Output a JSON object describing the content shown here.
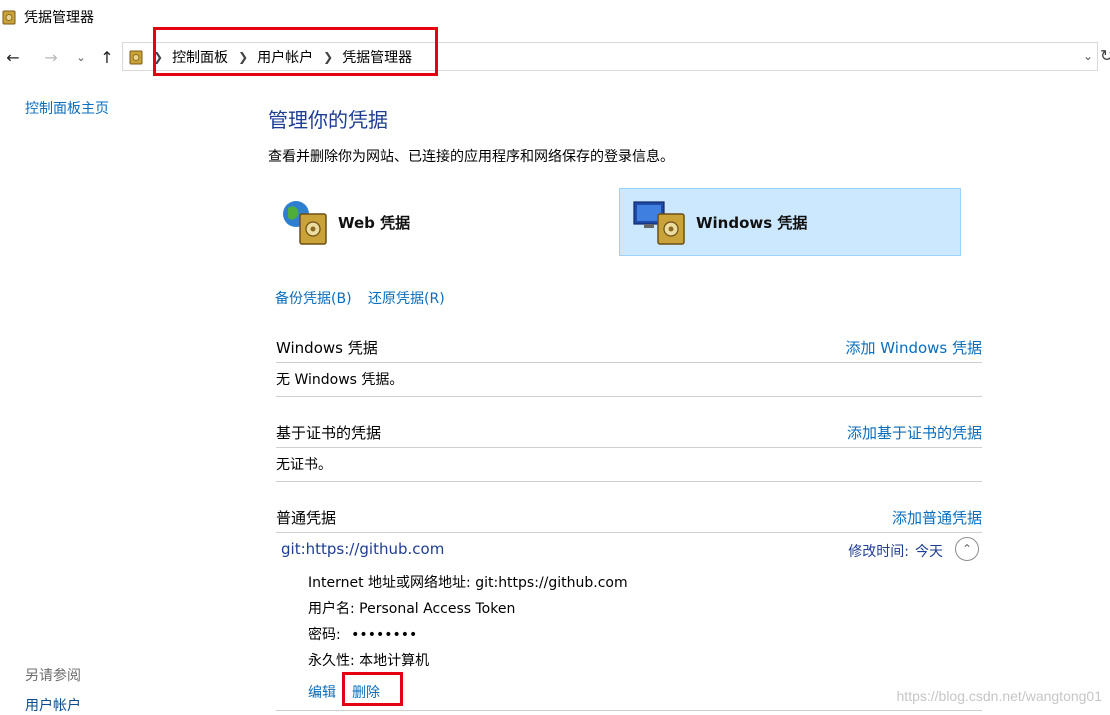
{
  "window": {
    "title": "凭据管理器"
  },
  "nav": {
    "back_icon": "arrow-left-icon",
    "forward_icon": "arrow-right-icon",
    "recent_icon": "chevron-down-icon",
    "up_icon": "arrow-up-icon",
    "breadcrumb": [
      "控制面板",
      "用户帐户",
      "凭据管理器"
    ]
  },
  "sidebar": {
    "home_link": "控制面板主页",
    "see_also": "另请参阅",
    "user_accounts": "用户帐户"
  },
  "main": {
    "title": "管理你的凭据",
    "description": "查看并删除你为网站、已连接的应用程序和网络保存的登录信息。",
    "categories": [
      {
        "label": "Web 凭据",
        "icon": "globe-vault-icon",
        "selected": false
      },
      {
        "label": "Windows 凭据",
        "icon": "computer-vault-icon",
        "selected": true
      }
    ],
    "backup": "备份凭据(B)",
    "restore": "还原凭据(R)",
    "sections": {
      "windows": {
        "title": "Windows 凭据",
        "add": "添加 Windows 凭据",
        "empty": "无 Windows 凭据。"
      },
      "certificate": {
        "title": "基于证书的凭据",
        "add": "添加基于证书的凭据",
        "empty": "无证书。"
      },
      "generic": {
        "title": "普通凭据",
        "add": "添加普通凭据"
      }
    },
    "credential": {
      "name": "git:https://github.com",
      "modified_label": "修改时间:",
      "modified_value": "今天",
      "address": "Internet 地址或网络地址: git:https://github.com",
      "username": "用户名: Personal Access Token",
      "password_label": "密码:",
      "password_mask": "••••••••",
      "persistence": "永久性: 本地计算机",
      "edit": "编辑",
      "delete": "删除"
    }
  },
  "watermark": "https://blog.csdn.net/wangtong01",
  "colors": {
    "highlight": "#e50012",
    "link": "#0a6dbd",
    "heading": "#1e3e93",
    "selected_tile": "#cce8ff"
  }
}
